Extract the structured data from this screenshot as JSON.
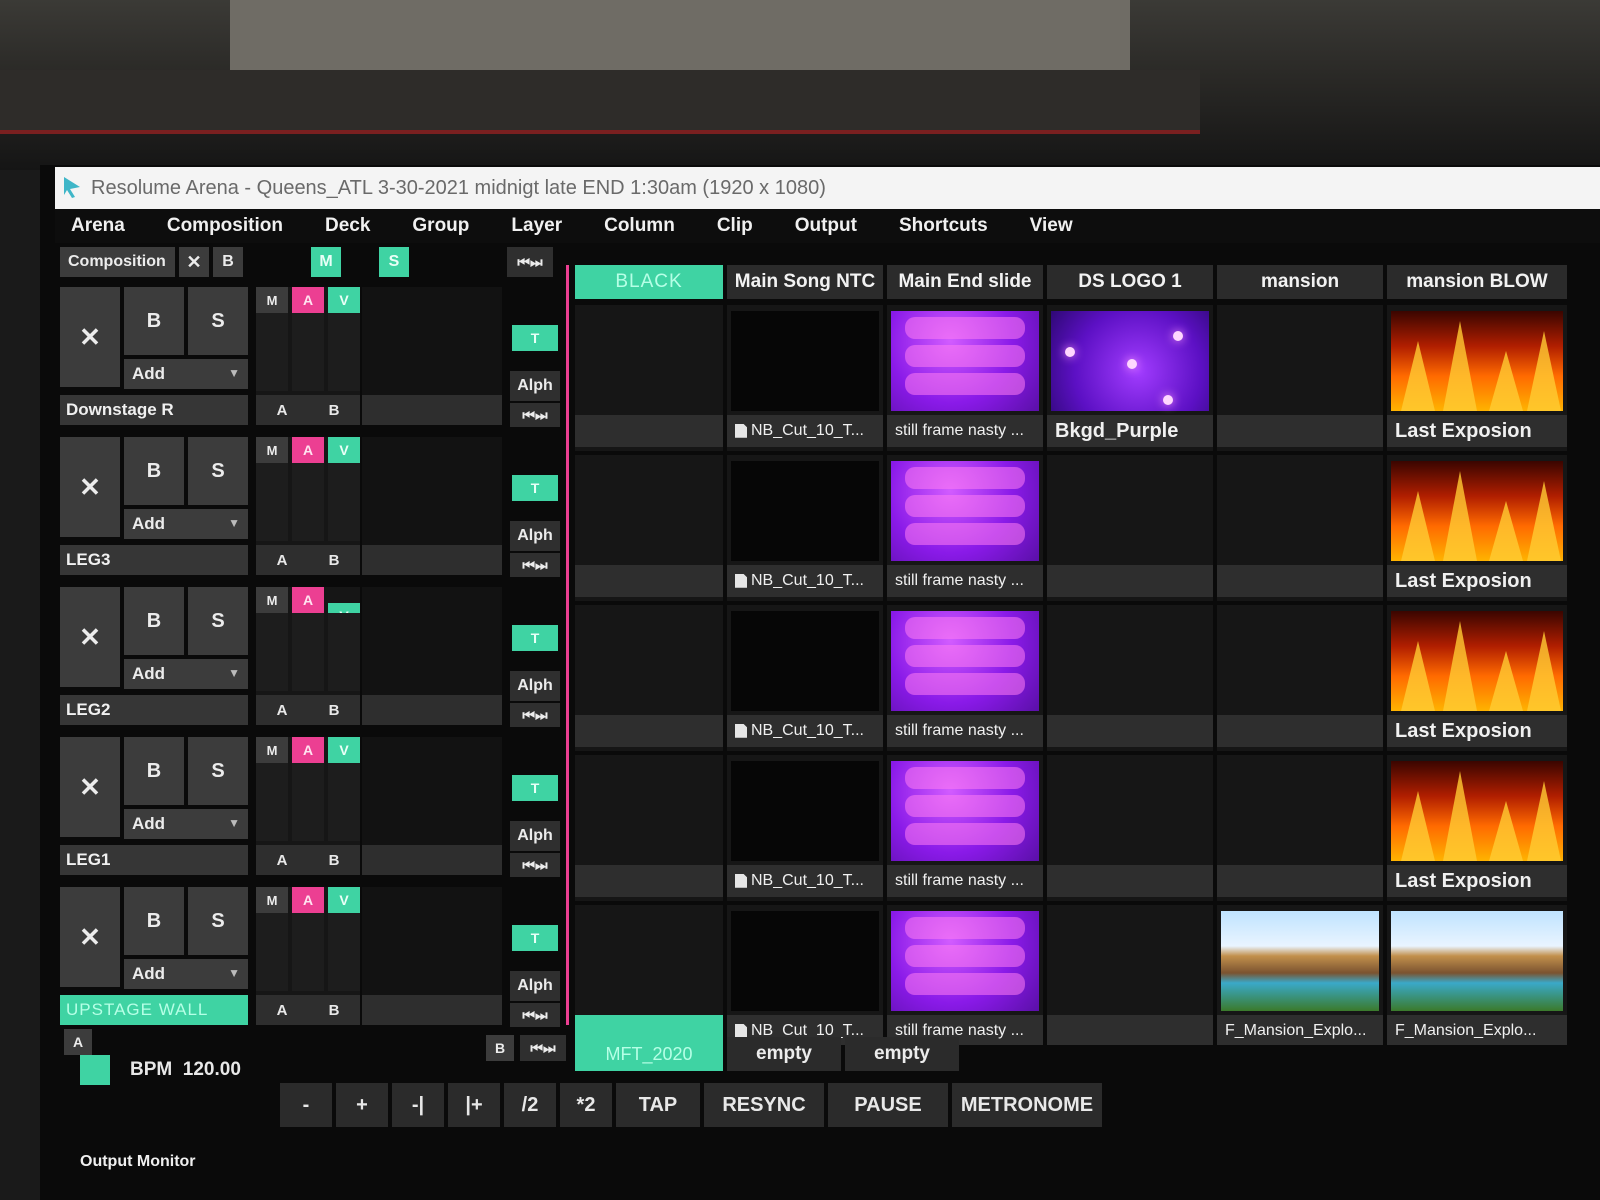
{
  "window": {
    "title": "Resolume Arena - Queens_ATL 3-30-2021 midnigt late END 1:30am (1920 x 1080)"
  },
  "menu": [
    "Arena",
    "Composition",
    "Deck",
    "Group",
    "Layer",
    "Column",
    "Clip",
    "Output",
    "Shortcuts",
    "View"
  ],
  "composition_bar": {
    "label": "Composition",
    "x": "✕",
    "b": "B",
    "m": "M",
    "s": "S",
    "skip": "⏮⏭"
  },
  "layer_common": {
    "x": "✕",
    "b": "B",
    "s": "S",
    "add": "Add",
    "m": "M",
    "a": "A",
    "v": "V",
    "ab_a": "A",
    "ab_b": "B",
    "t": "T",
    "alph": "Alph",
    "skip": "⏮⏭"
  },
  "layers": [
    {
      "name": "Downstage R"
    },
    {
      "name": "LEG3"
    },
    {
      "name": "LEG2"
    },
    {
      "name": "LEG1"
    },
    {
      "name": "UPSTAGE WALL"
    }
  ],
  "columns": [
    "BLACK",
    "Main Song NTC",
    "Main End slide",
    "DS LOGO 1",
    "mansion",
    "mansion BLOW"
  ],
  "clips": {
    "nb_cut": "NB_Cut_10_T...",
    "still_frame": "still frame nasty ...",
    "bkgd_purple": "Bkgd_Purple",
    "last_exposion": "Last Exposion",
    "f_mansion": "F_Mansion_Explo..."
  },
  "bottom_row": {
    "a_btn": "A",
    "b_btn": "B",
    "skip": "⏮⏭",
    "column_name": "MFT_2020",
    "empty1": "empty",
    "empty2": "empty"
  },
  "transport": {
    "bpm_label": "BPM",
    "bpm_value": "120.00",
    "buttons": [
      "-",
      "+",
      "-|",
      "|+",
      "/2",
      "*2",
      "TAP",
      "RESYNC",
      "PAUSE",
      "METRONOME"
    ]
  },
  "output_monitor": "Output Monitor",
  "colors": {
    "accent_green": "#3fd3a3",
    "accent_pink": "#ec3f92",
    "panel": "#2b2b2b"
  }
}
